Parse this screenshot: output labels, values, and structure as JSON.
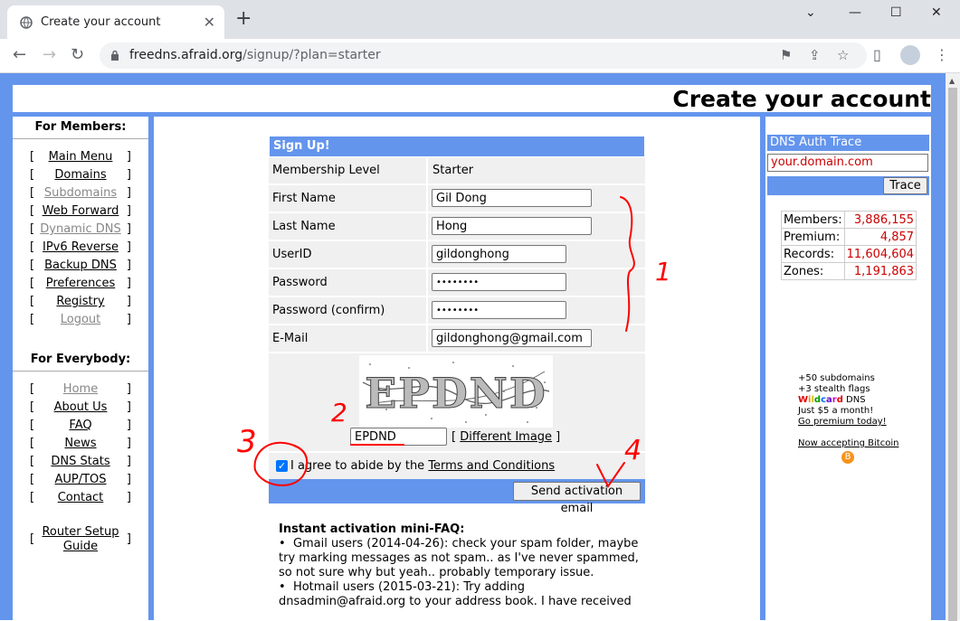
{
  "browser": {
    "tab_title": "Create your account",
    "new_tab": "+",
    "url_host": "freedns.afraid.org",
    "url_path": "/signup/?plan=starter",
    "controls": {
      "min": "—",
      "max": "☐",
      "close": "✕",
      "down": "⌄"
    }
  },
  "page": {
    "title": "Create your account"
  },
  "members": {
    "heading": "For Members:",
    "items": [
      {
        "label": "Main Menu",
        "gray": false
      },
      {
        "label": "Domains",
        "gray": false
      },
      {
        "label": "Subdomains",
        "gray": true
      },
      {
        "label": "Web Forward",
        "gray": false
      },
      {
        "label": "Dynamic DNS",
        "gray": true
      },
      {
        "label": "IPv6 Reverse",
        "gray": false
      },
      {
        "label": "Backup DNS",
        "gray": false
      },
      {
        "label": "Preferences",
        "gray": false
      },
      {
        "label": "Registry",
        "gray": false
      },
      {
        "label": "Logout",
        "gray": true
      }
    ]
  },
  "everybody": {
    "heading": "For Everybody:",
    "items": [
      {
        "label": "Home",
        "gray": true
      },
      {
        "label": "About Us",
        "gray": false
      },
      {
        "label": "FAQ",
        "gray": false
      },
      {
        "label": "News",
        "gray": false
      },
      {
        "label": "DNS Stats",
        "gray": false
      },
      {
        "label": "AUP/TOS",
        "gray": false
      },
      {
        "label": "Contact",
        "gray": false
      }
    ],
    "router_line1": "Router Setup",
    "router_line2": "Guide"
  },
  "signup": {
    "heading": "Sign Up!",
    "membership_label": "Membership Level",
    "membership_value": "Starter",
    "first_name_label": "First Name",
    "first_name": "Gil Dong",
    "last_name_label": "Last Name",
    "last_name": "Hong",
    "userid_label": "UserID",
    "userid": "gildonghong",
    "password_label": "Password",
    "password_mask": "••••••••",
    "password_confirm_label": "Password (confirm)",
    "password_confirm_mask": "••••••••",
    "email_label": "E-Mail",
    "email": "gildonghong@gmail.com",
    "captcha_text": "EPDND",
    "captcha_input": "EPDND",
    "different_image": "Different Image",
    "agree_prefix": "I agree to abide by the",
    "terms_link": "Terms and Conditions",
    "agreed": true,
    "send_button": "Send activation email"
  },
  "faq": {
    "heading": "Instant activation mini-FAQ:",
    "bullet1": "Gmail users (2014-04-26): check your spam folder, maybe try marking messages as not spam.. as I've never spammed, so not sure why but yeah.. probably temporary issue.",
    "bullet2": "Hotmail users (2015-03-21): Try adding dnsadmin@afraid.org to your address book. I have received"
  },
  "dns_trace": {
    "heading": "DNS Auth Trace",
    "input_value": "your.domain.com",
    "button": "Trace"
  },
  "stats": [
    {
      "label": "Members:",
      "value": "3,886,155"
    },
    {
      "label": "Premium:",
      "value": "4,857"
    },
    {
      "label": "Records:",
      "value": "11,604,604"
    },
    {
      "label": "Zones:",
      "value": "1,191,863"
    }
  ],
  "promo": {
    "line1": "+50 subdomains",
    "line2": "+3 stealth flags",
    "wildcard_word": "Wildcard",
    "line3_rest": " DNS",
    "line4": "Just $5 a month!",
    "line5": "Go premium today!",
    "bitcoin": "Now accepting Bitcoin",
    "bitcoin_symbol": "B"
  },
  "annotations": {
    "n1": "1",
    "n2": "2",
    "n3": "3",
    "n4": "4"
  },
  "colors": {
    "accent": "#6495ed",
    "stat_red": "#cc0000",
    "annotation": "#ff0000"
  }
}
